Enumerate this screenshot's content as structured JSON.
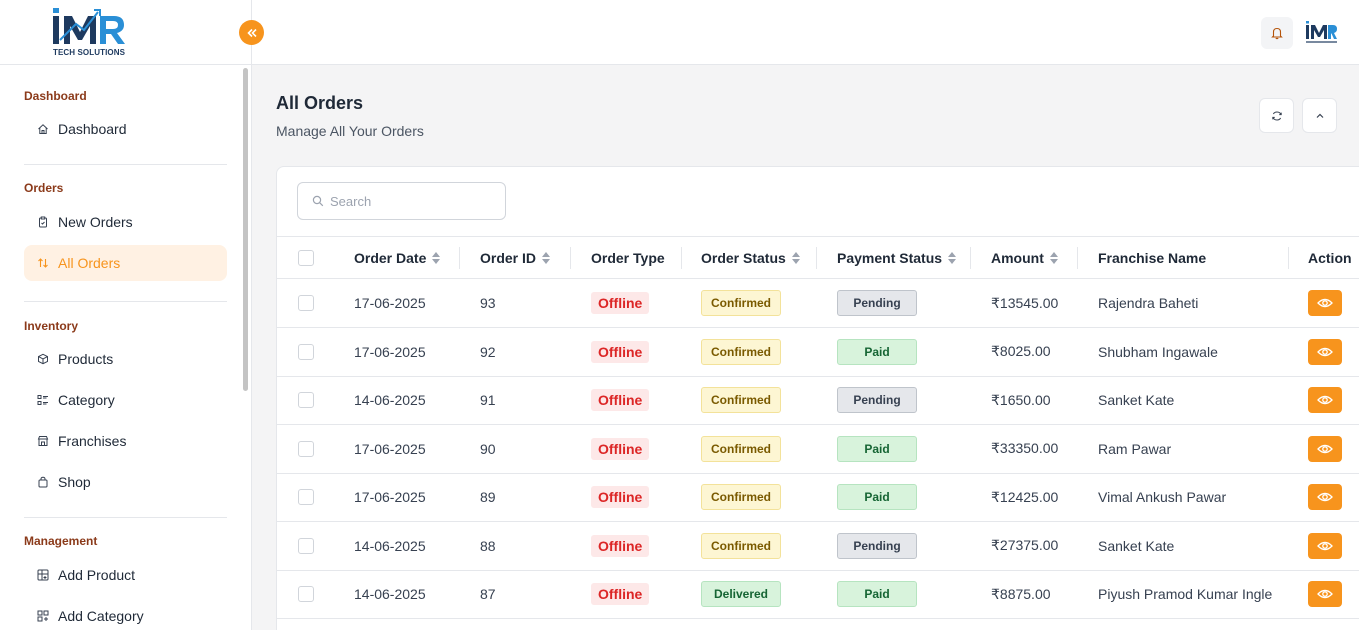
{
  "brand": {
    "logo_text": "iMR",
    "logo_sub": "TECH SOLUTIONS",
    "accent": "#f7941d"
  },
  "sidebar": {
    "sections": [
      {
        "title": "Dashboard",
        "items": [
          {
            "label": "Dashboard",
            "icon": "home-icon"
          }
        ]
      },
      {
        "title": "Orders",
        "items": [
          {
            "label": "New Orders",
            "icon": "clipboard-icon"
          },
          {
            "label": "All Orders",
            "icon": "sort-arrows-icon",
            "active": true
          }
        ]
      },
      {
        "title": "Inventory",
        "items": [
          {
            "label": "Products",
            "icon": "box-icon"
          },
          {
            "label": "Category",
            "icon": "list-icon"
          },
          {
            "label": "Franchises",
            "icon": "store-icon"
          },
          {
            "label": "Shop",
            "icon": "shopping-bag-icon"
          }
        ]
      },
      {
        "title": "Management",
        "items": [
          {
            "label": "Add Product",
            "icon": "grid-plus-icon"
          },
          {
            "label": "Add Category",
            "icon": "category-plus-icon"
          }
        ]
      }
    ]
  },
  "main": {
    "title": "All Orders",
    "subtitle": "Manage All Your Orders",
    "search_placeholder": "Search"
  },
  "table": {
    "columns": [
      "Order Date",
      "Order ID",
      "Order Type",
      "Order Status",
      "Payment Status",
      "Amount",
      "Franchise Name",
      "Action"
    ],
    "rows": [
      {
        "date": "17-06-2025",
        "id": "93",
        "type": "Offline",
        "status": "Confirmed",
        "payment": "Pending",
        "amount": "₹13545.00",
        "franchise": "Rajendra Baheti"
      },
      {
        "date": "17-06-2025",
        "id": "92",
        "type": "Offline",
        "status": "Confirmed",
        "payment": "Paid",
        "amount": "₹8025.00",
        "franchise": "Shubham Ingawale"
      },
      {
        "date": "14-06-2025",
        "id": "91",
        "type": "Offline",
        "status": "Confirmed",
        "payment": "Pending",
        "amount": "₹1650.00",
        "franchise": "Sanket Kate"
      },
      {
        "date": "17-06-2025",
        "id": "90",
        "type": "Offline",
        "status": "Confirmed",
        "payment": "Paid",
        "amount": "₹33350.00",
        "franchise": "Ram Pawar"
      },
      {
        "date": "17-06-2025",
        "id": "89",
        "type": "Offline",
        "status": "Confirmed",
        "payment": "Paid",
        "amount": "₹12425.00",
        "franchise": "Vimal Ankush Pawar"
      },
      {
        "date": "14-06-2025",
        "id": "88",
        "type": "Offline",
        "status": "Confirmed",
        "payment": "Pending",
        "amount": "₹27375.00",
        "franchise": "Sanket Kate"
      },
      {
        "date": "14-06-2025",
        "id": "87",
        "type": "Offline",
        "status": "Delivered",
        "payment": "Paid",
        "amount": "₹8875.00",
        "franchise": "Piyush Pramod Kumar Ingle"
      }
    ]
  }
}
